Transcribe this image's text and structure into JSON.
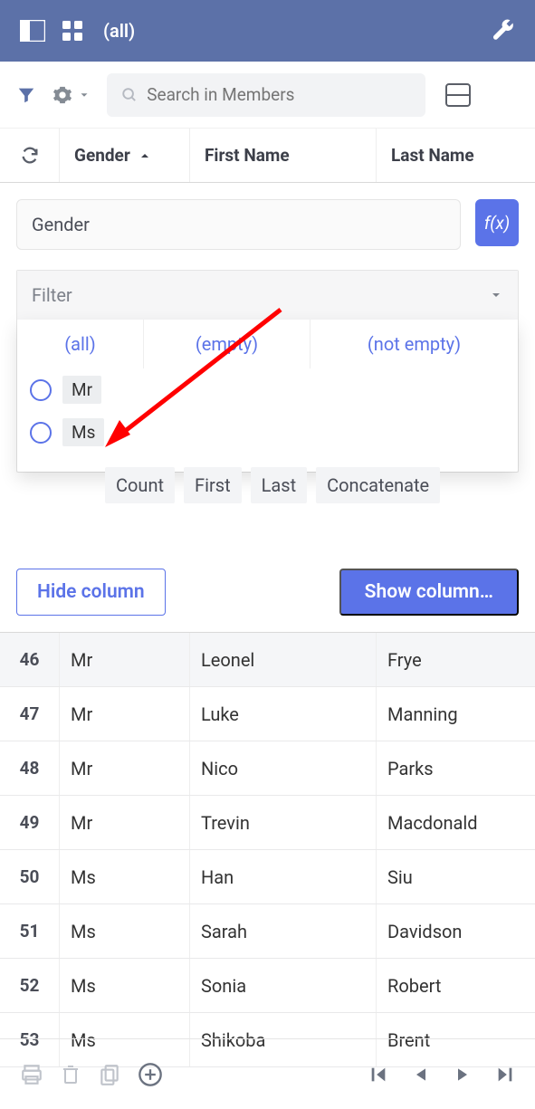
{
  "topbar": {
    "context_label": "(all)"
  },
  "toolbar": {
    "search_placeholder": "Search in Members"
  },
  "headers": {
    "gender": "Gender",
    "first_name": "First Name",
    "last_name": "Last Name"
  },
  "panel": {
    "field_label": "Gender",
    "filter_label": "Filter",
    "tabs": {
      "all": "(all)",
      "empty": "(empty)",
      "not_empty": "(not empty)"
    },
    "options": [
      "Mr",
      "Ms"
    ],
    "aggregates": [
      "Count",
      "First",
      "Last",
      "Concatenate"
    ],
    "hide_btn": "Hide column",
    "show_btn": "Show column…"
  },
  "rows": [
    {
      "n": "46",
      "gender": "Mr",
      "first": "Leonel",
      "last": "Frye"
    },
    {
      "n": "47",
      "gender": "Mr",
      "first": "Luke",
      "last": "Manning"
    },
    {
      "n": "48",
      "gender": "Mr",
      "first": "Nico",
      "last": "Parks"
    },
    {
      "n": "49",
      "gender": "Mr",
      "first": "Trevin",
      "last": "Macdonald"
    },
    {
      "n": "50",
      "gender": "Ms",
      "first": "Han",
      "last": "Siu"
    },
    {
      "n": "51",
      "gender": "Ms",
      "first": "Sarah",
      "last": "Davidson"
    },
    {
      "n": "52",
      "gender": "Ms",
      "first": "Sonia",
      "last": "Robert"
    },
    {
      "n": "53",
      "gender": "Ms",
      "first": "Shikoba",
      "last": "Brent"
    }
  ]
}
